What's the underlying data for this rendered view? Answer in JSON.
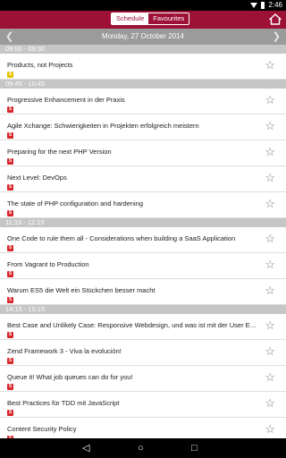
{
  "status_bar": {
    "time": "2:46"
  },
  "app_bar": {
    "segments": [
      "Schedule",
      "Favourites"
    ],
    "active_segment": "Favourites"
  },
  "date_bar": {
    "date": "Monday, 27 October 2014"
  },
  "colors": {
    "accent": "#9e1137",
    "slot_bg": "#c6c6c6",
    "badge_yellow": "#e6c300",
    "badge_red": "#d9262b"
  },
  "schedule": [
    {
      "time": "09:00 - 09:30",
      "talks": [
        {
          "title": "Products, not Projects",
          "badge": "S",
          "badge_color": "yellow"
        }
      ]
    },
    {
      "time": "09:45 - 10:45",
      "talks": [
        {
          "title": "Progressive Enhancement in der Praxis",
          "badge": "S",
          "badge_color": "red"
        },
        {
          "title": "Agile Xchange: Schwierigkeiten in Projekten erfolgreich meistern",
          "badge": "S",
          "badge_color": "red"
        },
        {
          "title": "Preparing for the next PHP Version",
          "badge": "S",
          "badge_color": "red"
        },
        {
          "title": "Next Level: DevOps",
          "badge": "S",
          "badge_color": "red"
        },
        {
          "title": "The state of PHP configuration and hardening",
          "badge": "S",
          "badge_color": "red"
        }
      ]
    },
    {
      "time": "11:15 - 12:15",
      "talks": [
        {
          "title": "One Code to rule them all - Considerations when building a SaaS Application",
          "badge": "S",
          "badge_color": "red"
        },
        {
          "title": "From Vagrant to Production",
          "badge": "S",
          "badge_color": "red"
        },
        {
          "title": "Warum ES5 die Welt ein Stückchen besser macht",
          "badge": "S",
          "badge_color": "red"
        }
      ]
    },
    {
      "time": "14:15 - 15:15",
      "talks": [
        {
          "title": "Best Case and Unlikely Case: Responsive Webdesign, und was ist mit der User Exp...",
          "badge": "S",
          "badge_color": "red"
        },
        {
          "title": "Zend Framework 3 - Viva la evolución!",
          "badge": "S",
          "badge_color": "red"
        },
        {
          "title": "Queue it! What job queues can do for you!",
          "badge": "S",
          "badge_color": "red"
        },
        {
          "title": "Best Practices für TDD mit JavaScript",
          "badge": "S",
          "badge_color": "red"
        },
        {
          "title": "Content Security Policy",
          "badge": "S",
          "badge_color": "red"
        }
      ]
    }
  ]
}
